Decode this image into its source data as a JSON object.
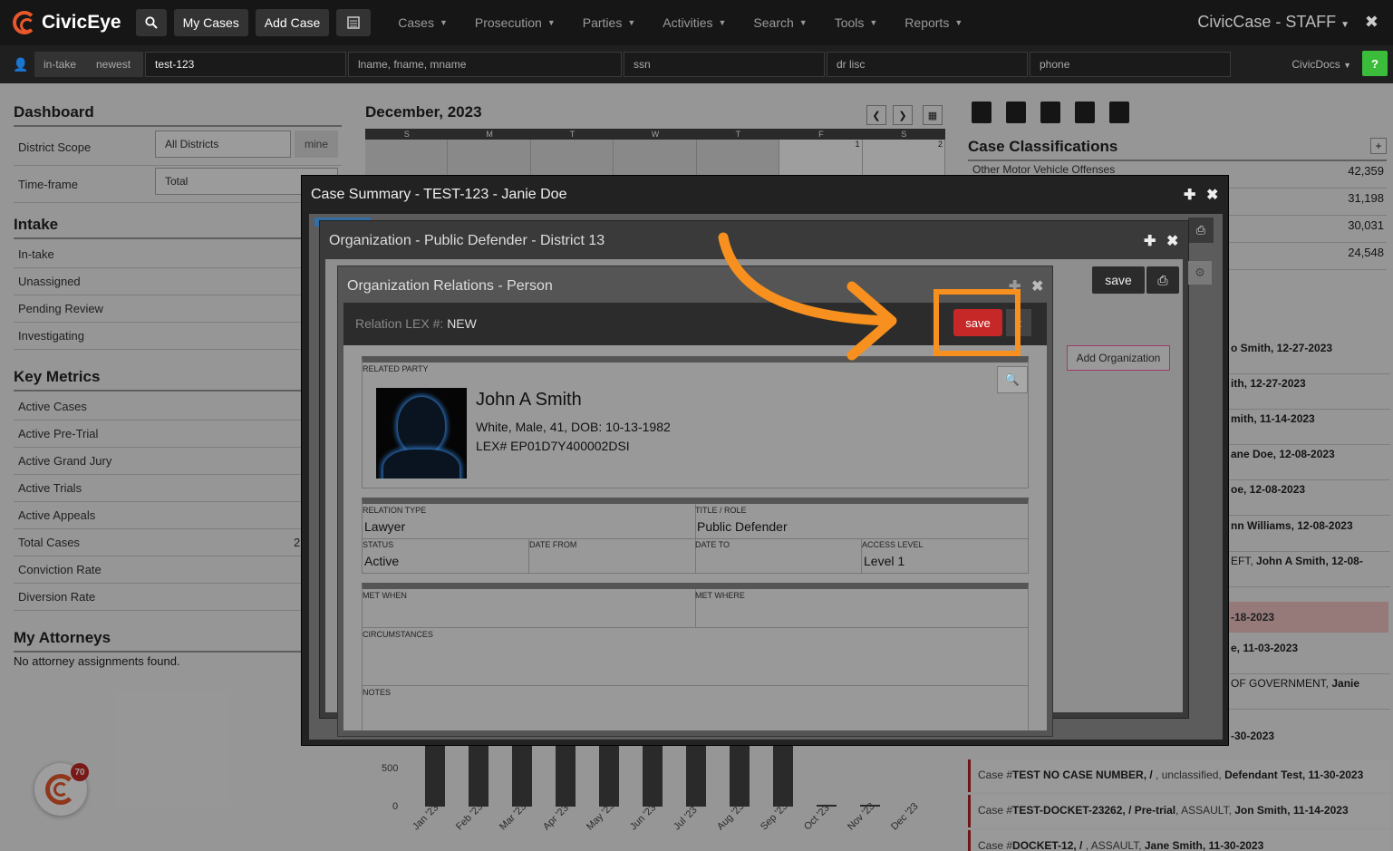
{
  "topbar": {
    "brand": "CivicEye",
    "my_cases": "My Cases",
    "add_case": "Add Case",
    "menus": [
      "Cases",
      "Prosecution",
      "Parties",
      "Activities",
      "Search",
      "Tools",
      "Reports"
    ],
    "app_title": "CivicCase - STAFF",
    "icons": {
      "search": "search-icon",
      "calculator": "calculator-icon",
      "close": "close-icon"
    }
  },
  "searchbar": {
    "intake": "in-take",
    "newest": "newest",
    "case_value": "test-123",
    "name_placeholder": "lname, fname, mname",
    "ssn_placeholder": "ssn",
    "dl_placeholder": "dr lisc",
    "phone_placeholder": "phone",
    "docs": "CivicDocs",
    "help": "?"
  },
  "dashboard": {
    "title": "Dashboard",
    "district_scope_label": "District Scope",
    "district_scope_value": "All Districts",
    "mine": "mine",
    "timeframe_label": "Time-frame",
    "timeframe_value": "Total",
    "intake_title": "Intake",
    "intake_items": [
      "In-take",
      "Unassigned",
      "Pending Review",
      "Investigating"
    ],
    "metrics_title": "Key Metrics",
    "metrics_items": [
      "Active Cases",
      "Active Pre-Trial",
      "Active Grand Jury",
      "Active Trials",
      "Active Appeals",
      "Total Cases",
      "Conviction Rate",
      "Diversion Rate"
    ],
    "total_cases_partial": "2",
    "attorneys_title": "My Attorneys",
    "attorneys_empty": "No attorney assignments found."
  },
  "calendar": {
    "title": "December, 2023",
    "days": [
      "S",
      "M",
      "T",
      "W",
      "T",
      "F",
      "S"
    ],
    "dates": [
      "",
      "",
      "",
      "",
      "",
      "1",
      "2"
    ]
  },
  "classifications": {
    "title": "Case Classifications",
    "first_name": "Other Motor Vehicle Offenses",
    "values": [
      "42,359",
      "31,198",
      "30,031",
      "24,548"
    ]
  },
  "activity": {
    "items": [
      {
        "pre": "",
        "bold": "o Smith, 12-27-2023"
      },
      {
        "pre": "",
        "bold": "ith, 12-27-2023"
      },
      {
        "pre": "",
        "bold": "mith, 11-14-2023"
      },
      {
        "pre": "",
        "bold": "ane Doe, 12-08-2023"
      },
      {
        "pre": "",
        "bold": "oe, 12-08-2023"
      },
      {
        "pre": "",
        "bold": "nn Williams, 12-08-2023"
      },
      {
        "pre": "EFT, ",
        "bold": "John A Smith, 12-08-"
      }
    ],
    "pink": "-18-2023",
    "more": [
      {
        "pre": "",
        "bold": "e, 11-03-2023"
      },
      {
        "pre": "OF GOVERNMENT, ",
        "bold": "Janie"
      },
      {
        "pre": "",
        "bold": "-30-2023"
      }
    ],
    "full": [
      {
        "a": "Case #",
        "b": "TEST NO CASE NUMBER, / ",
        "c": ", unclassified, ",
        "d": "Defendant Test, 11-30-2023"
      },
      {
        "a": "Case #",
        "b": "TEST-DOCKET-23262, / Pre-trial",
        "c": ", ASSAULT, ",
        "d": "Jon Smith, 11-14-2023"
      },
      {
        "a": "Case #",
        "b": "DOCKET-12, / ",
        "c": ", ASSAULT, ",
        "d": "Jane Smith, 11-30-2023"
      }
    ]
  },
  "chart_data": {
    "type": "bar",
    "categories": [
      "Jan '23",
      "Feb '23",
      "Mar '23",
      "Apr '23",
      "May '23",
      "Jun '23",
      "Jul '23",
      "Aug '23",
      "Sep '23",
      "Oct '23",
      "Nov '23",
      "Dec '23"
    ],
    "values": [
      1200,
      1200,
      1200,
      1200,
      1200,
      1200,
      1200,
      1200,
      1200,
      10,
      15,
      0
    ],
    "yticks": [
      "500",
      "0"
    ],
    "ylim": [
      0,
      1200
    ]
  },
  "badge": {
    "count": "70"
  },
  "modal_case": {
    "title": "Case Summary - TEST-123 - Janie Doe"
  },
  "modal_org": {
    "title": "Organization - Public Defender - District 13",
    "save": "save",
    "add_org": "Add Organization"
  },
  "modal_rel": {
    "title": "Organization Relations - Person",
    "lex_label": "Relation LEX #:",
    "lex_value": "NEW",
    "save": "save",
    "x": "x",
    "related_party_label": "Related Party",
    "person_name": "John A Smith",
    "person_details": "White, Male, 41, DOB: 10-13-1982",
    "person_lex": "LEX# EP01D7Y400002DSI",
    "relation_type_label": "Relation Type",
    "relation_type": "Lawyer",
    "title_role_label": "Title / Role",
    "title_role": "Public Defender",
    "status_label": "Status",
    "status": "Active",
    "date_from_label": "Date From",
    "date_to_label": "Date To",
    "access_level_label": "Access Level",
    "access_level": "Level 1",
    "met_when_label": "Met When",
    "met_where_label": "Met Where",
    "circumstances_label": "Circumstances",
    "notes_label": "Notes"
  },
  "colors": {
    "accent": "#f7901e",
    "save": "#c62828",
    "help": "#3bbd3b",
    "brand": "#e9582d"
  }
}
